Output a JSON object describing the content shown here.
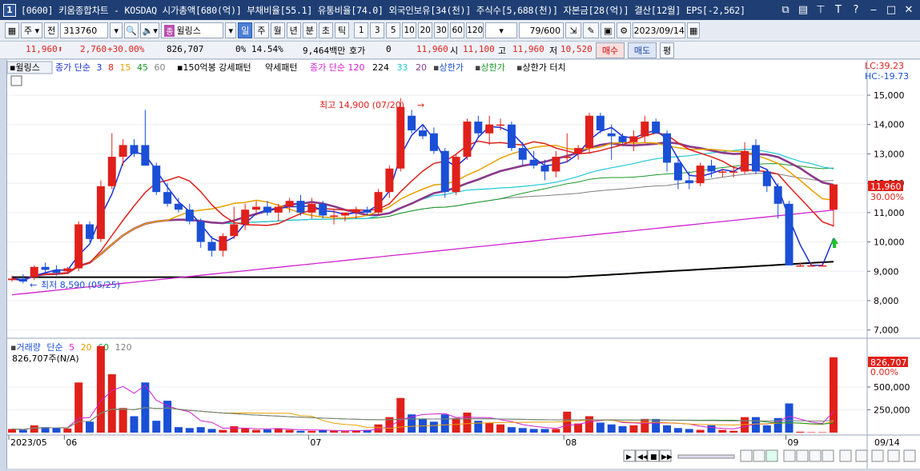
{
  "window": {
    "number": "1",
    "title": "[0600] 키움종합차트 - KOSDAQ 시가총액[680(억)] 부채비율[55.1] 유통비율[74.0] 외국인보유[34(천)] 주식수[5,688(천)] 자본금[28(억)] 결산[12월] EPS[-2,562]",
    "buttons": [
      "⧉",
      "▤",
      "⊤",
      "T",
      "?",
      "‒",
      "□",
      "✕"
    ]
  },
  "toolbar": {
    "period_type": "주",
    "prev_label": "전",
    "code": "313760",
    "stock_name": "윌링스",
    "name_tag": "종",
    "intervals": [
      "일",
      "주",
      "월",
      "년",
      "분",
      "초",
      "틱"
    ],
    "selected_interval": "일",
    "minute_values": [
      "1",
      "3",
      "5",
      "10",
      "20",
      "30",
      "60",
      "120"
    ],
    "range": "79/600",
    "date": "2023/09/14"
  },
  "quote": {
    "price": "11,960",
    "change": "2,760",
    "change_pct": "+30.00%",
    "volume": "826,707",
    "ratio_label": "0%",
    "turnover_pct": "14.54%",
    "amount": "9,464백만",
    "hoga_label": "호가",
    "hoga_value": "0",
    "current": "11,960",
    "open_label": "시",
    "open": "11,100",
    "high_label": "고",
    "high": "11,960",
    "low_label": "저",
    "low": "10,520",
    "buy_btn": "매수",
    "sell_btn": "매도",
    "eval_btn": "평"
  },
  "legend": {
    "name": "윌링스",
    "ma_label": "종가 단순",
    "ma_periods": [
      "3",
      "8",
      "15",
      "45",
      "60"
    ],
    "pattern1": "150억봉 강세패턴",
    "pattern2": "약세패턴",
    "ma2_label": "종가 단순 120",
    "ma2_periods": [
      "224",
      "33",
      "20"
    ],
    "upper1": "상한가",
    "upper2": "상한가",
    "upper3": "상한가 터치",
    "lc": "LC:39.23",
    "hc": "HC:-19.73"
  },
  "volume_legend": {
    "label": "거래량",
    "ma_label": "단순",
    "periods": [
      "5",
      "20",
      "60",
      "120"
    ],
    "current": "826,707주(N/A)",
    "badge_value": "826,707",
    "badge_pct": "0.00%"
  },
  "annotations": {
    "high": "최고 14,900 (07/20)",
    "low": "최저 8,590 (05/25)",
    "price_badge": "11,960",
    "price_badge_pct": "30.00%"
  },
  "x_labels": [
    "2023/05",
    "06",
    "07",
    "08",
    "09",
    "09/14"
  ],
  "colors": {
    "up": "#e0201a",
    "down": "#1a4fd6",
    "ma3": "#1a2fd6",
    "ma8": "#e0201a",
    "ma15": "#e8a000",
    "ma45": "#1a9a2a",
    "ma60": "#808080",
    "ma120": "#d020d0",
    "ma224": "#000000",
    "ma33": "#20c8d8",
    "ma20": "#8a3a8a"
  },
  "chart_data": {
    "type": "candlestick",
    "price_axis": {
      "ticks": [
        "15,000",
        "14,000",
        "13,000",
        "12,000",
        "11,000",
        "10,000",
        "9,000",
        "8,000",
        "7,000"
      ],
      "range": [
        6800,
        15600
      ]
    },
    "volume_axis": {
      "ticks": [
        "500,000",
        "250,000"
      ],
      "range": [
        0,
        1000000
      ]
    },
    "candles": [
      [
        8700,
        8850,
        8650,
        8750
      ],
      [
        8750,
        8900,
        8590,
        8650
      ],
      [
        8800,
        9200,
        8700,
        9150
      ],
      [
        9150,
        9300,
        8950,
        9050
      ],
      [
        9050,
        9200,
        8850,
        8950
      ],
      [
        9000,
        9150,
        8900,
        9100
      ],
      [
        9100,
        10700,
        9000,
        10600
      ],
      [
        10600,
        10700,
        10000,
        10100
      ],
      [
        10100,
        12100,
        10000,
        11900
      ],
      [
        11900,
        13700,
        11800,
        12900
      ],
      [
        12900,
        13500,
        12600,
        13300
      ],
      [
        13300,
        13500,
        12900,
        13000
      ],
      [
        13300,
        14500,
        12600,
        12600
      ],
      [
        12600,
        12700,
        11600,
        11700
      ],
      [
        11700,
        12000,
        11200,
        11300
      ],
      [
        11300,
        11500,
        11000,
        11100
      ],
      [
        11100,
        11300,
        10600,
        10700
      ],
      [
        10700,
        10800,
        9800,
        10000
      ],
      [
        10000,
        10200,
        9500,
        9700
      ],
      [
        9700,
        10300,
        9500,
        10200
      ],
      [
        10200,
        11200,
        10100,
        10600
      ],
      [
        10600,
        11300,
        10400,
        11100
      ],
      [
        11100,
        11400,
        10900,
        11200
      ],
      [
        11200,
        11400,
        10900,
        11000
      ],
      [
        11000,
        11300,
        10700,
        11200
      ],
      [
        11200,
        11500,
        11000,
        11400
      ],
      [
        11400,
        11600,
        10900,
        11000
      ],
      [
        11000,
        11500,
        10800,
        11300
      ],
      [
        11300,
        11400,
        10800,
        10900
      ],
      [
        10900,
        11100,
        10600,
        10900
      ],
      [
        10900,
        11000,
        10700,
        11000
      ],
      [
        11000,
        11200,
        10800,
        11100
      ],
      [
        11100,
        11200,
        10900,
        11000
      ],
      [
        11000,
        11800,
        10900,
        11700
      ],
      [
        11700,
        12600,
        11500,
        12500
      ],
      [
        12500,
        14900,
        12400,
        14600
      ],
      [
        14300,
        14500,
        13700,
        13800
      ],
      [
        13800,
        14000,
        13500,
        13600
      ],
      [
        13700,
        13900,
        13000,
        13100
      ],
      [
        13100,
        13200,
        11500,
        11700
      ],
      [
        11700,
        13000,
        11600,
        12900
      ],
      [
        12900,
        14200,
        12800,
        14100
      ],
      [
        14100,
        14300,
        13600,
        13700
      ],
      [
        13700,
        14300,
        13300,
        14000
      ],
      [
        14000,
        14200,
        13800,
        14000
      ],
      [
        14000,
        14100,
        13100,
        13200
      ],
      [
        13200,
        13400,
        12600,
        12800
      ],
      [
        12800,
        13100,
        12500,
        12600
      ],
      [
        12600,
        12800,
        12100,
        12400
      ],
      [
        12400,
        13100,
        12200,
        12900
      ],
      [
        12900,
        13700,
        12700,
        12900
      ],
      [
        13000,
        13300,
        12800,
        13200
      ],
      [
        13200,
        14400,
        13000,
        14300
      ],
      [
        14300,
        14400,
        13700,
        13800
      ],
      [
        13700,
        14000,
        12800,
        13600
      ],
      [
        13600,
        13700,
        13300,
        13400
      ],
      [
        13400,
        13800,
        13100,
        13600
      ],
      [
        13600,
        14300,
        13400,
        14100
      ],
      [
        14100,
        14200,
        13700,
        13700
      ],
      [
        13700,
        13800,
        12400,
        12700
      ],
      [
        12700,
        12900,
        11800,
        12100
      ],
      [
        12100,
        12400,
        11800,
        12000
      ],
      [
        12000,
        12700,
        11900,
        12600
      ],
      [
        12600,
        12800,
        12200,
        12400
      ],
      [
        12400,
        12500,
        12200,
        12400
      ],
      [
        12400,
        12600,
        12200,
        12400
      ],
      [
        12400,
        13400,
        12300,
        13100
      ],
      [
        13300,
        13500,
        12300,
        12400
      ],
      [
        12400,
        12500,
        11700,
        11900
      ],
      [
        11900,
        12000,
        10800,
        11300
      ],
      [
        11300,
        11400,
        9200,
        9200
      ],
      [
        9200,
        9300,
        9200,
        9200
      ],
      [
        9200,
        9300,
        9200,
        9200
      ],
      [
        9200,
        9300,
        9200,
        9200
      ],
      [
        11100,
        11960,
        10520,
        11960
      ]
    ],
    "volumes": [
      40000,
      30000,
      80000,
      60000,
      55000,
      45000,
      550000,
      120000,
      950000,
      640000,
      270000,
      180000,
      550000,
      130000,
      350000,
      60000,
      50000,
      60000,
      40000,
      30000,
      70000,
      45000,
      30000,
      35000,
      45000,
      30000,
      20000,
      20000,
      30000,
      20000,
      15000,
      25000,
      30000,
      90000,
      170000,
      380000,
      200000,
      150000,
      120000,
      200000,
      160000,
      220000,
      130000,
      110000,
      90000,
      60000,
      50000,
      40000,
      40000,
      40000,
      230000,
      100000,
      180000,
      110000,
      90000,
      70000,
      80000,
      150000,
      150000,
      80000,
      50000,
      40000,
      30000,
      80000,
      30000,
      20000,
      170000,
      170000,
      80000,
      160000,
      320000,
      10000,
      5000,
      5000,
      826707
    ],
    "x_categories_labels": [
      "2023/05",
      "06",
      "07",
      "08",
      "09",
      "09/14"
    ],
    "title": "",
    "xlabel": "",
    "ylabel": ""
  }
}
